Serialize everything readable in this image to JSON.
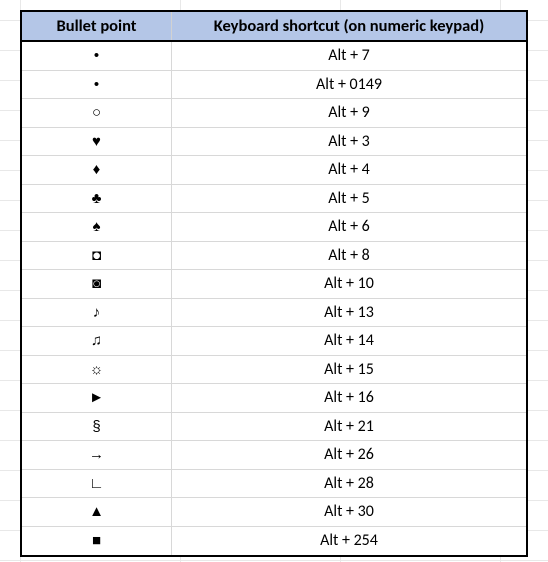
{
  "chart_data": {
    "type": "table",
    "columns": [
      "Bullet point",
      "Keyboard shortcut (on numeric keypad)"
    ],
    "rows": [
      {
        "bullet": "•",
        "shortcut": "Alt + 7"
      },
      {
        "bullet": "•",
        "shortcut": "Alt + 0149"
      },
      {
        "bullet": "○",
        "shortcut": "Alt + 9"
      },
      {
        "bullet": "♥",
        "shortcut": "Alt + 3"
      },
      {
        "bullet": "♦",
        "shortcut": "Alt + 4"
      },
      {
        "bullet": "♣",
        "shortcut": "Alt + 5"
      },
      {
        "bullet": "♠",
        "shortcut": "Alt + 6"
      },
      {
        "bullet": "◘",
        "shortcut": "Alt + 8"
      },
      {
        "bullet": "◙",
        "shortcut": "Alt + 10"
      },
      {
        "bullet": "♪",
        "shortcut": "Alt + 13"
      },
      {
        "bullet": "♫",
        "shortcut": "Alt + 14"
      },
      {
        "bullet": "☼",
        "shortcut": "Alt + 15"
      },
      {
        "bullet": "►",
        "shortcut": "Alt + 16"
      },
      {
        "bullet": "§",
        "shortcut": "Alt + 21"
      },
      {
        "bullet": "→",
        "shortcut": "Alt + 26"
      },
      {
        "bullet": "∟",
        "shortcut": "Alt + 28"
      },
      {
        "bullet": "▲",
        "shortcut": "Alt + 30"
      },
      {
        "bullet": "■",
        "shortcut": "Alt + 254"
      }
    ]
  },
  "headers": {
    "col_a": "Bullet point",
    "col_b": "Keyboard shortcut (on numeric keypad)"
  }
}
